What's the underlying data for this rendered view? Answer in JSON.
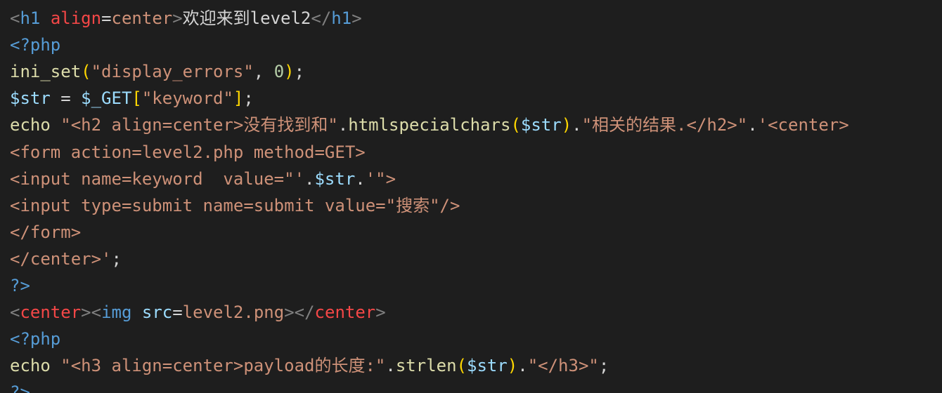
{
  "theme": {
    "background": "#1e1e1e",
    "colors": {
      "punct": "#808080",
      "tag": "#569cd6",
      "deprecated": "#f44747",
      "attr": "#9cdcfe",
      "text": "#d4d4d4",
      "func": "#dcdcaa",
      "string": "#ce9178",
      "number": "#b5cea8",
      "variable": "#9cdcfe",
      "bracket": "#ffd700",
      "bracket2": "#da70d6"
    }
  },
  "editor": {
    "lines": [
      [
        [
          "bracket",
          "  }"
        ]
      ],
      [
        [
          "punct",
          "<"
        ],
        [
          "tag",
          "h1"
        ],
        [
          "text",
          " "
        ],
        [
          "deprecated",
          "align"
        ],
        [
          "text",
          "="
        ],
        [
          "string",
          "center"
        ],
        [
          "punct",
          ">"
        ],
        [
          "text",
          "欢迎来到level2"
        ],
        [
          "punct",
          "</"
        ],
        [
          "tag",
          "h1"
        ],
        [
          "punct",
          ">"
        ]
      ],
      [
        [
          "tag",
          "<?php"
        ]
      ],
      [
        [
          "func",
          "ini_set"
        ],
        [
          "bracket",
          "("
        ],
        [
          "string",
          "\"display_errors\""
        ],
        [
          "text",
          ", "
        ],
        [
          "number",
          "0"
        ],
        [
          "bracket",
          ")"
        ],
        [
          "text",
          ";"
        ]
      ],
      [
        [
          "variable",
          "$str"
        ],
        [
          "text",
          " = "
        ],
        [
          "variable",
          "$_GET"
        ],
        [
          "bracket",
          "["
        ],
        [
          "string",
          "\"keyword\""
        ],
        [
          "bracket",
          "]"
        ],
        [
          "text",
          ";"
        ]
      ],
      [
        [
          "func",
          "echo"
        ],
        [
          "text",
          " "
        ],
        [
          "string",
          "\"<h2 align=center>没有找到和\""
        ],
        [
          "text",
          "."
        ],
        [
          "func",
          "htmlspecialchars"
        ],
        [
          "bracket",
          "("
        ],
        [
          "variable",
          "$str"
        ],
        [
          "bracket",
          ")"
        ],
        [
          "text",
          "."
        ],
        [
          "string",
          "\"相关的结果.</h2>\""
        ],
        [
          "text",
          "."
        ],
        [
          "string",
          "'<center>"
        ]
      ],
      [
        [
          "string",
          "<form action=level2.php method=GET>"
        ]
      ],
      [
        [
          "string",
          "<input name=keyword  value=\"'"
        ],
        [
          "text",
          "."
        ],
        [
          "variable",
          "$str"
        ],
        [
          "text",
          "."
        ],
        [
          "string",
          "'\">"
        ]
      ],
      [
        [
          "string",
          "<input type=submit name=submit value=\"搜索\"/>"
        ]
      ],
      [
        [
          "string",
          "</form>"
        ]
      ],
      [
        [
          "string",
          "</center>'"
        ],
        [
          "text",
          ";"
        ]
      ],
      [
        [
          "tag",
          "?>"
        ]
      ],
      [
        [
          "punct",
          "<"
        ],
        [
          "deprecated",
          "center"
        ],
        [
          "punct",
          "><"
        ],
        [
          "tag",
          "img"
        ],
        [
          "text",
          " "
        ],
        [
          "attr",
          "src"
        ],
        [
          "text",
          "="
        ],
        [
          "string",
          "level2.png"
        ],
        [
          "punct",
          "></"
        ],
        [
          "deprecated",
          "center"
        ],
        [
          "punct",
          ">"
        ]
      ],
      [
        [
          "tag",
          "<?php"
        ]
      ],
      [
        [
          "func",
          "echo"
        ],
        [
          "text",
          " "
        ],
        [
          "string",
          "\"<h3 align=center>payload的长度:\""
        ],
        [
          "text",
          "."
        ],
        [
          "func",
          "strlen"
        ],
        [
          "bracket",
          "("
        ],
        [
          "variable",
          "$str"
        ],
        [
          "bracket",
          ")"
        ],
        [
          "text",
          "."
        ],
        [
          "string",
          "\"</h3>\""
        ],
        [
          "text",
          ";"
        ]
      ],
      [
        [
          "tag",
          "?>"
        ]
      ]
    ]
  }
}
